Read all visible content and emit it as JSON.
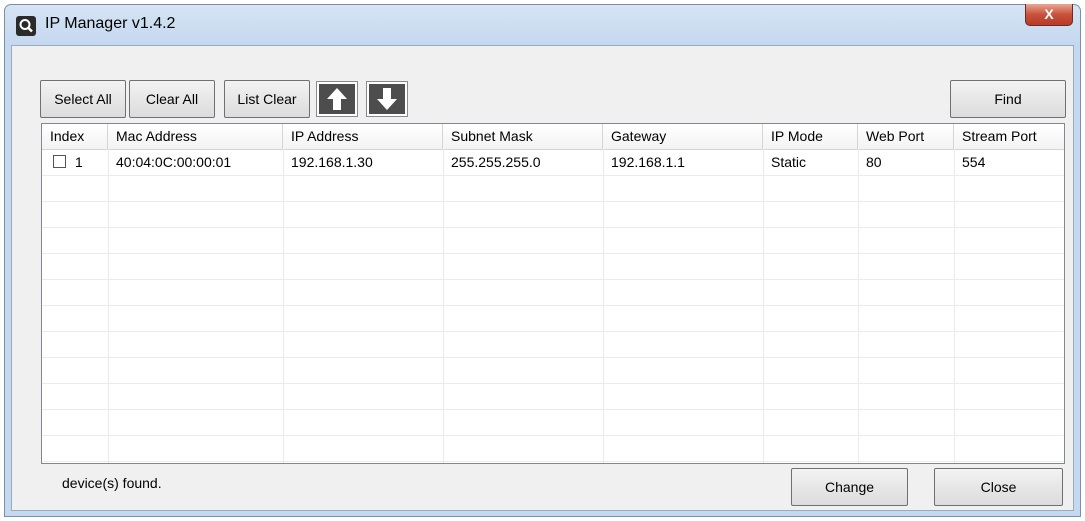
{
  "window": {
    "title": "IP Manager v1.4.2",
    "close_glyph": "X",
    "icon": "search-magnifier-icon"
  },
  "toolbar": {
    "select_all": "Select All",
    "clear_all": "Clear All",
    "list_clear": "List Clear",
    "move_up_icon": "arrow-up-icon",
    "move_down_icon": "arrow-down-icon",
    "find": "Find"
  },
  "table": {
    "columns": [
      "Index",
      "Mac Address",
      "IP Address",
      "Subnet Mask",
      "Gateway",
      "IP Mode",
      "Web Port",
      "Stream Port"
    ],
    "rows": [
      {
        "checked": false,
        "index": "1",
        "mac": "40:04:0C:00:00:01",
        "ip": "192.168.1.30",
        "subnet": "255.255.255.0",
        "gateway": "192.168.1.1",
        "mode": "Static",
        "web_port": "80",
        "stream_port": "554"
      }
    ]
  },
  "status": {
    "text": "device(s) found."
  },
  "footer": {
    "change": "Change",
    "close": "Close"
  }
}
